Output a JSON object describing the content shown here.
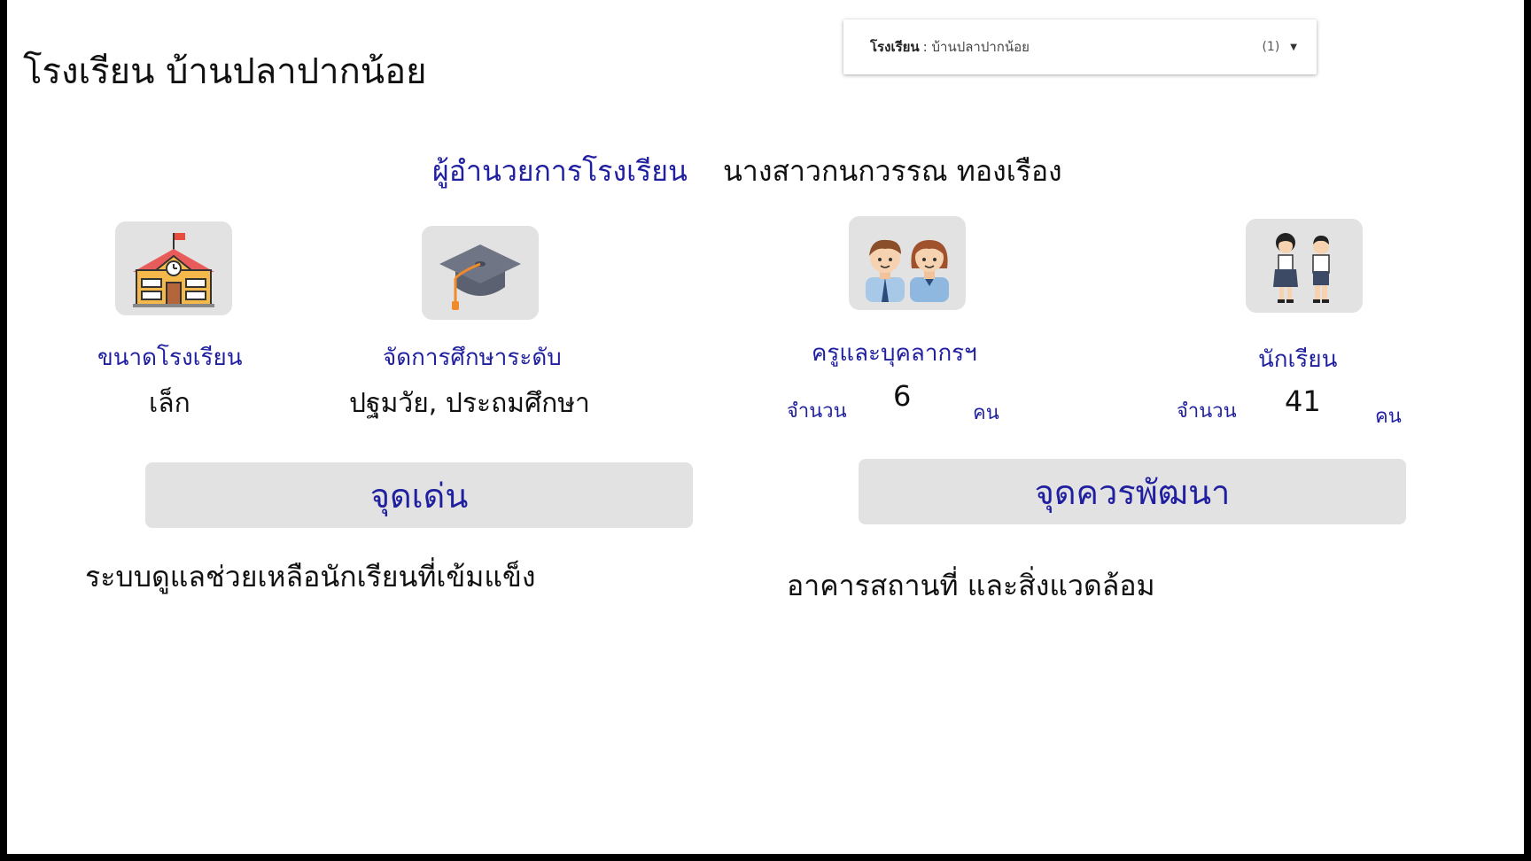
{
  "school": {
    "title": "โรงเรียน บ้านปลาปากน้อย"
  },
  "filter": {
    "label": "โรงเรียน",
    "value": ": บ้านปลาปากน้อย",
    "count": "(1)",
    "icon": "caret-down-icon"
  },
  "director": {
    "label": "ผู้อำนวยการโรงเรียน",
    "name": "นางสาวกนกวรรณ ทองเรือง"
  },
  "cards": {
    "size": {
      "label": "ขนาดโรงเรียน",
      "value": "เล็ก",
      "icon": "school-building-icon"
    },
    "level": {
      "label": "จัดการศึกษาระดับ",
      "value": "ปฐมวัย, ประถมศึกษา",
      "icon": "graduation-cap-icon"
    },
    "staff": {
      "label": "ครูและบุคลากรฯ",
      "count_label": "จำนวน",
      "count": "6",
      "unit": "คน",
      "icon": "teachers-icon"
    },
    "students": {
      "label": "นักเรียน",
      "count_label": "จำนวน",
      "count": "41",
      "unit": "คน",
      "icon": "students-icon"
    }
  },
  "strengths": {
    "title": "จุดเด่น",
    "text": "ระบบดูแลช่วยเหลือนักเรียนที่เข้มแข็ง"
  },
  "improvements": {
    "title": "จุดควรพัฒนา",
    "text": "อาคารสถานที่ และสิ่งแวดล้อม"
  },
  "colors": {
    "accent": "#1f1fa0",
    "tile": "#e2e2e2",
    "text": "#111111"
  }
}
